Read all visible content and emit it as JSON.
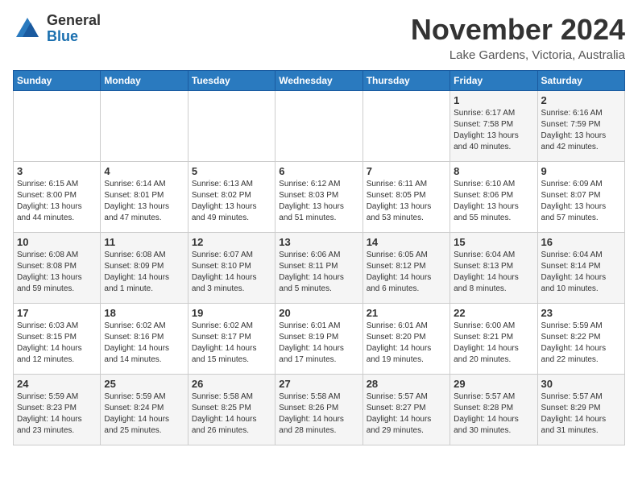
{
  "header": {
    "logo_general": "General",
    "logo_blue": "Blue",
    "month_title": "November 2024",
    "location": "Lake Gardens, Victoria, Australia"
  },
  "weekdays": [
    "Sunday",
    "Monday",
    "Tuesday",
    "Wednesday",
    "Thursday",
    "Friday",
    "Saturday"
  ],
  "weeks": [
    [
      {
        "day": "",
        "info": ""
      },
      {
        "day": "",
        "info": ""
      },
      {
        "day": "",
        "info": ""
      },
      {
        "day": "",
        "info": ""
      },
      {
        "day": "",
        "info": ""
      },
      {
        "day": "1",
        "info": "Sunrise: 6:17 AM\nSunset: 7:58 PM\nDaylight: 13 hours\nand 40 minutes."
      },
      {
        "day": "2",
        "info": "Sunrise: 6:16 AM\nSunset: 7:59 PM\nDaylight: 13 hours\nand 42 minutes."
      }
    ],
    [
      {
        "day": "3",
        "info": "Sunrise: 6:15 AM\nSunset: 8:00 PM\nDaylight: 13 hours\nand 44 minutes."
      },
      {
        "day": "4",
        "info": "Sunrise: 6:14 AM\nSunset: 8:01 PM\nDaylight: 13 hours\nand 47 minutes."
      },
      {
        "day": "5",
        "info": "Sunrise: 6:13 AM\nSunset: 8:02 PM\nDaylight: 13 hours\nand 49 minutes."
      },
      {
        "day": "6",
        "info": "Sunrise: 6:12 AM\nSunset: 8:03 PM\nDaylight: 13 hours\nand 51 minutes."
      },
      {
        "day": "7",
        "info": "Sunrise: 6:11 AM\nSunset: 8:05 PM\nDaylight: 13 hours\nand 53 minutes."
      },
      {
        "day": "8",
        "info": "Sunrise: 6:10 AM\nSunset: 8:06 PM\nDaylight: 13 hours\nand 55 minutes."
      },
      {
        "day": "9",
        "info": "Sunrise: 6:09 AM\nSunset: 8:07 PM\nDaylight: 13 hours\nand 57 minutes."
      }
    ],
    [
      {
        "day": "10",
        "info": "Sunrise: 6:08 AM\nSunset: 8:08 PM\nDaylight: 13 hours\nand 59 minutes."
      },
      {
        "day": "11",
        "info": "Sunrise: 6:08 AM\nSunset: 8:09 PM\nDaylight: 14 hours\nand 1 minute."
      },
      {
        "day": "12",
        "info": "Sunrise: 6:07 AM\nSunset: 8:10 PM\nDaylight: 14 hours\nand 3 minutes."
      },
      {
        "day": "13",
        "info": "Sunrise: 6:06 AM\nSunset: 8:11 PM\nDaylight: 14 hours\nand 5 minutes."
      },
      {
        "day": "14",
        "info": "Sunrise: 6:05 AM\nSunset: 8:12 PM\nDaylight: 14 hours\nand 6 minutes."
      },
      {
        "day": "15",
        "info": "Sunrise: 6:04 AM\nSunset: 8:13 PM\nDaylight: 14 hours\nand 8 minutes."
      },
      {
        "day": "16",
        "info": "Sunrise: 6:04 AM\nSunset: 8:14 PM\nDaylight: 14 hours\nand 10 minutes."
      }
    ],
    [
      {
        "day": "17",
        "info": "Sunrise: 6:03 AM\nSunset: 8:15 PM\nDaylight: 14 hours\nand 12 minutes."
      },
      {
        "day": "18",
        "info": "Sunrise: 6:02 AM\nSunset: 8:16 PM\nDaylight: 14 hours\nand 14 minutes."
      },
      {
        "day": "19",
        "info": "Sunrise: 6:02 AM\nSunset: 8:17 PM\nDaylight: 14 hours\nand 15 minutes."
      },
      {
        "day": "20",
        "info": "Sunrise: 6:01 AM\nSunset: 8:19 PM\nDaylight: 14 hours\nand 17 minutes."
      },
      {
        "day": "21",
        "info": "Sunrise: 6:01 AM\nSunset: 8:20 PM\nDaylight: 14 hours\nand 19 minutes."
      },
      {
        "day": "22",
        "info": "Sunrise: 6:00 AM\nSunset: 8:21 PM\nDaylight: 14 hours\nand 20 minutes."
      },
      {
        "day": "23",
        "info": "Sunrise: 5:59 AM\nSunset: 8:22 PM\nDaylight: 14 hours\nand 22 minutes."
      }
    ],
    [
      {
        "day": "24",
        "info": "Sunrise: 5:59 AM\nSunset: 8:23 PM\nDaylight: 14 hours\nand 23 minutes."
      },
      {
        "day": "25",
        "info": "Sunrise: 5:59 AM\nSunset: 8:24 PM\nDaylight: 14 hours\nand 25 minutes."
      },
      {
        "day": "26",
        "info": "Sunrise: 5:58 AM\nSunset: 8:25 PM\nDaylight: 14 hours\nand 26 minutes."
      },
      {
        "day": "27",
        "info": "Sunrise: 5:58 AM\nSunset: 8:26 PM\nDaylight: 14 hours\nand 28 minutes."
      },
      {
        "day": "28",
        "info": "Sunrise: 5:57 AM\nSunset: 8:27 PM\nDaylight: 14 hours\nand 29 minutes."
      },
      {
        "day": "29",
        "info": "Sunrise: 5:57 AM\nSunset: 8:28 PM\nDaylight: 14 hours\nand 30 minutes."
      },
      {
        "day": "30",
        "info": "Sunrise: 5:57 AM\nSunset: 8:29 PM\nDaylight: 14 hours\nand 31 minutes."
      }
    ]
  ]
}
